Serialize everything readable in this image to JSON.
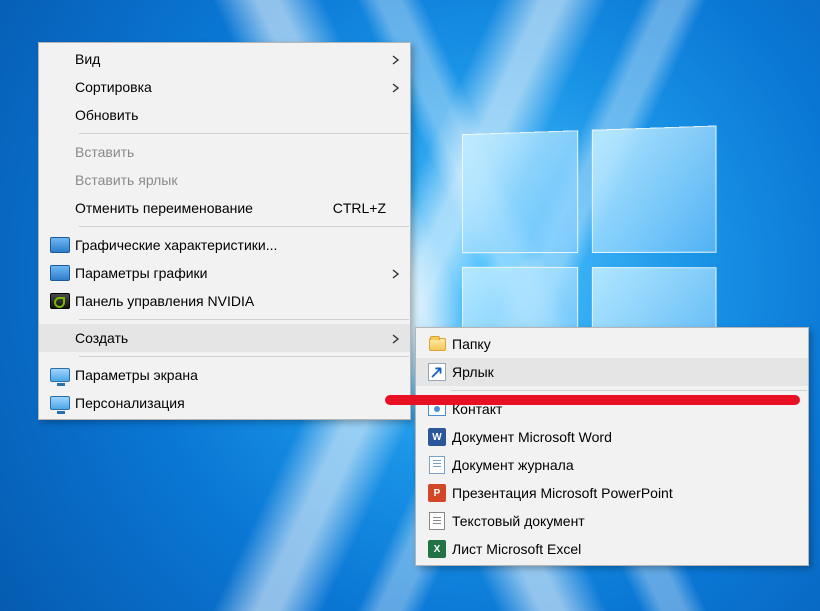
{
  "main_menu": {
    "view": {
      "label": "Вид"
    },
    "sort": {
      "label": "Сортировка"
    },
    "refresh": {
      "label": "Обновить"
    },
    "paste": {
      "label": "Вставить"
    },
    "paste_link": {
      "label": "Вставить ярлык"
    },
    "undo": {
      "label": "Отменить переименование",
      "shortcut": "CTRL+Z"
    },
    "intel_gfx": {
      "label": "Графические характеристики..."
    },
    "intel_opts": {
      "label": "Параметры графики"
    },
    "nvidia": {
      "label": "Панель управления NVIDIA"
    },
    "new": {
      "label": "Создать"
    },
    "display": {
      "label": "Параметры экрана"
    },
    "personalize": {
      "label": "Персонализация"
    }
  },
  "sub_menu": {
    "folder": {
      "label": "Папку"
    },
    "shortcut": {
      "label": "Ярлык"
    },
    "contact": {
      "label": "Контакт"
    },
    "word": {
      "label": "Документ Microsoft Word"
    },
    "journal": {
      "label": "Документ журнала"
    },
    "ppt": {
      "label": "Презентация Microsoft PowerPoint"
    },
    "text": {
      "label": "Текстовый документ"
    },
    "excel": {
      "label": "Лист Microsoft Excel"
    }
  },
  "icons": {
    "word_glyph": "W",
    "ppt_glyph": "P",
    "excel_glyph": "X"
  }
}
